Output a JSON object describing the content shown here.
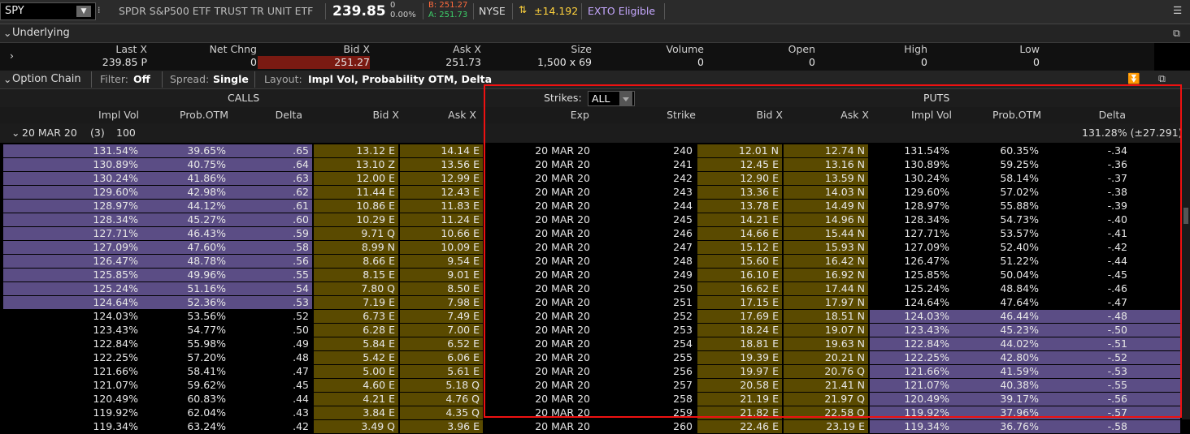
{
  "topbar": {
    "symbol": "SPY",
    "description": "SPDR S&P500 ETF TRUST TR UNIT ETF",
    "last": "239.85",
    "change_top": "0",
    "change_pct": "0.00%",
    "bid": "B: 251.27",
    "ask": "A: 251.73",
    "exchange": "NYSE",
    "expected_move": "±14.192",
    "exto": "EXTO Eligible",
    "colors": {
      "bid": "#ff6a3d",
      "ask": "#3dd16a",
      "exto": "#c6a8ff",
      "move": "#ffd23d"
    }
  },
  "underlying": {
    "title": "Underlying",
    "headers": [
      "Last X",
      "Net Chng",
      "Bid X",
      "Ask X",
      "Size",
      "Volume",
      "Open",
      "High",
      "Low"
    ],
    "values": [
      "239.85 P",
      "0",
      "251.27",
      "251.73",
      "1,500 x 69",
      "0",
      "0",
      "0",
      "0"
    ]
  },
  "chain_bar": {
    "title": "Option Chain",
    "filter_label": "Filter:",
    "filter_value": "Off",
    "spread_label": "Spread:",
    "spread_value": "Single",
    "layout_label": "Layout:",
    "layout_value": "Impl Vol, Probability OTM, Delta"
  },
  "chain": {
    "calls_title": "CALLS",
    "puts_title": "PUTS",
    "strikes_label": "Strikes:",
    "strikes_value": "ALL",
    "call_headers": [
      "Impl Vol",
      "Prob.OTM",
      "Delta",
      "Bid X",
      "Ask X"
    ],
    "mid_headers": [
      "Exp",
      "Strike"
    ],
    "put_headers": [
      "Bid X",
      "Ask X",
      "Impl Vol",
      "Prob.OTM",
      "Delta"
    ],
    "expiration": {
      "label": "20 MAR 20",
      "count": "(3)",
      "multiplier": "100",
      "puts_iv": "131.28% (±27.291)"
    },
    "rows": [
      {
        "civ": "131.54%",
        "cotm": "39.65%",
        "cdelta": ".65",
        "cbid": "13.12 E",
        "cask": "14.14 E",
        "exp": "20 MAR 20",
        "strike": "240",
        "pbid": "12.01 N",
        "pask": "12.74 N",
        "piv": "131.54%",
        "potm": "60.35%",
        "pdelta": "-.34"
      },
      {
        "civ": "130.89%",
        "cotm": "40.75%",
        "cdelta": ".64",
        "cbid": "13.10 Z",
        "cask": "13.56 E",
        "exp": "20 MAR 20",
        "strike": "241",
        "pbid": "12.45 E",
        "pask": "13.16 N",
        "piv": "130.89%",
        "potm": "59.25%",
        "pdelta": "-.36"
      },
      {
        "civ": "130.24%",
        "cotm": "41.86%",
        "cdelta": ".63",
        "cbid": "12.00 E",
        "cask": "12.99 E",
        "exp": "20 MAR 20",
        "strike": "242",
        "pbid": "12.90 E",
        "pask": "13.59 N",
        "piv": "130.24%",
        "potm": "58.14%",
        "pdelta": "-.37"
      },
      {
        "civ": "129.60%",
        "cotm": "42.98%",
        "cdelta": ".62",
        "cbid": "11.44 E",
        "cask": "12.43 E",
        "exp": "20 MAR 20",
        "strike": "243",
        "pbid": "13.36 E",
        "pask": "14.03 N",
        "piv": "129.60%",
        "potm": "57.02%",
        "pdelta": "-.38"
      },
      {
        "civ": "128.97%",
        "cotm": "44.12%",
        "cdelta": ".61",
        "cbid": "10.86 E",
        "cask": "11.83 E",
        "exp": "20 MAR 20",
        "strike": "244",
        "pbid": "13.78 E",
        "pask": "14.49 N",
        "piv": "128.97%",
        "potm": "55.88%",
        "pdelta": "-.39"
      },
      {
        "civ": "128.34%",
        "cotm": "45.27%",
        "cdelta": ".60",
        "cbid": "10.29 E",
        "cask": "11.24 E",
        "exp": "20 MAR 20",
        "strike": "245",
        "pbid": "14.21 E",
        "pask": "14.96 N",
        "piv": "128.34%",
        "potm": "54.73%",
        "pdelta": "-.40"
      },
      {
        "civ": "127.71%",
        "cotm": "46.43%",
        "cdelta": ".59",
        "cbid": "9.71 Q",
        "cask": "10.66 E",
        "exp": "20 MAR 20",
        "strike": "246",
        "pbid": "14.66 E",
        "pask": "15.44 N",
        "piv": "127.71%",
        "potm": "53.57%",
        "pdelta": "-.41"
      },
      {
        "civ": "127.09%",
        "cotm": "47.60%",
        "cdelta": ".58",
        "cbid": "8.99 N",
        "cask": "10.09 E",
        "exp": "20 MAR 20",
        "strike": "247",
        "pbid": "15.12 E",
        "pask": "15.93 N",
        "piv": "127.09%",
        "potm": "52.40%",
        "pdelta": "-.42"
      },
      {
        "civ": "126.47%",
        "cotm": "48.78%",
        "cdelta": ".56",
        "cbid": "8.66 E",
        "cask": "9.54 E",
        "exp": "20 MAR 20",
        "strike": "248",
        "pbid": "15.60 E",
        "pask": "16.42 N",
        "piv": "126.47%",
        "potm": "51.22%",
        "pdelta": "-.44"
      },
      {
        "civ": "125.85%",
        "cotm": "49.96%",
        "cdelta": ".55",
        "cbid": "8.15 E",
        "cask": "9.01 E",
        "exp": "20 MAR 20",
        "strike": "249",
        "pbid": "16.10 E",
        "pask": "16.92 N",
        "piv": "125.85%",
        "potm": "50.04%",
        "pdelta": "-.45"
      },
      {
        "civ": "125.24%",
        "cotm": "51.16%",
        "cdelta": ".54",
        "cbid": "7.80 Q",
        "cask": "8.50 E",
        "exp": "20 MAR 20",
        "strike": "250",
        "pbid": "16.62 E",
        "pask": "17.44 N",
        "piv": "125.24%",
        "potm": "48.84%",
        "pdelta": "-.46"
      },
      {
        "civ": "124.64%",
        "cotm": "52.36%",
        "cdelta": ".53",
        "cbid": "7.19 E",
        "cask": "7.98 E",
        "exp": "20 MAR 20",
        "strike": "251",
        "pbid": "17.15 E",
        "pask": "17.97 N",
        "piv": "124.64%",
        "potm": "47.64%",
        "pdelta": "-.47"
      },
      {
        "civ": "124.03%",
        "cotm": "53.56%",
        "cdelta": ".52",
        "cbid": "6.73 E",
        "cask": "7.49 E",
        "exp": "20 MAR 20",
        "strike": "252",
        "pbid": "17.69 E",
        "pask": "18.51 N",
        "piv": "124.03%",
        "potm": "46.44%",
        "pdelta": "-.48"
      },
      {
        "civ": "123.43%",
        "cotm": "54.77%",
        "cdelta": ".50",
        "cbid": "6.28 E",
        "cask": "7.00 E",
        "exp": "20 MAR 20",
        "strike": "253",
        "pbid": "18.24 E",
        "pask": "19.07 N",
        "piv": "123.43%",
        "potm": "45.23%",
        "pdelta": "-.50"
      },
      {
        "civ": "122.84%",
        "cotm": "55.98%",
        "cdelta": ".49",
        "cbid": "5.84 E",
        "cask": "6.52 E",
        "exp": "20 MAR 20",
        "strike": "254",
        "pbid": "18.81 E",
        "pask": "19.63 N",
        "piv": "122.84%",
        "potm": "44.02%",
        "pdelta": "-.51"
      },
      {
        "civ": "122.25%",
        "cotm": "57.20%",
        "cdelta": ".48",
        "cbid": "5.42 E",
        "cask": "6.06 E",
        "exp": "20 MAR 20",
        "strike": "255",
        "pbid": "19.39 E",
        "pask": "20.21 N",
        "piv": "122.25%",
        "potm": "42.80%",
        "pdelta": "-.52"
      },
      {
        "civ": "121.66%",
        "cotm": "58.41%",
        "cdelta": ".47",
        "cbid": "5.00 E",
        "cask": "5.61 E",
        "exp": "20 MAR 20",
        "strike": "256",
        "pbid": "19.97 E",
        "pask": "20.76 Q",
        "piv": "121.66%",
        "potm": "41.59%",
        "pdelta": "-.53"
      },
      {
        "civ": "121.07%",
        "cotm": "59.62%",
        "cdelta": ".45",
        "cbid": "4.60 E",
        "cask": "5.18 Q",
        "exp": "20 MAR 20",
        "strike": "257",
        "pbid": "20.58 E",
        "pask": "21.41 N",
        "piv": "121.07%",
        "potm": "40.38%",
        "pdelta": "-.55"
      },
      {
        "civ": "120.49%",
        "cotm": "60.83%",
        "cdelta": ".44",
        "cbid": "4.21 E",
        "cask": "4.76 Q",
        "exp": "20 MAR 20",
        "strike": "258",
        "pbid": "21.19 E",
        "pask": "21.97 Q",
        "piv": "120.49%",
        "potm": "39.17%",
        "pdelta": "-.56"
      },
      {
        "civ": "119.92%",
        "cotm": "62.04%",
        "cdelta": ".43",
        "cbid": "3.84 E",
        "cask": "4.35 Q",
        "exp": "20 MAR 20",
        "strike": "259",
        "pbid": "21.82 E",
        "pask": "22.58 Q",
        "piv": "119.92%",
        "potm": "37.96%",
        "pdelta": "-.57"
      },
      {
        "civ": "119.34%",
        "cotm": "63.24%",
        "cdelta": ".42",
        "cbid": "3.49 Q",
        "cask": "3.96 E",
        "exp": "20 MAR 20",
        "strike": "260",
        "pbid": "22.46 E",
        "pask": "23.19 E",
        "piv": "119.34%",
        "potm": "36.76%",
        "pdelta": "-.58"
      }
    ]
  }
}
